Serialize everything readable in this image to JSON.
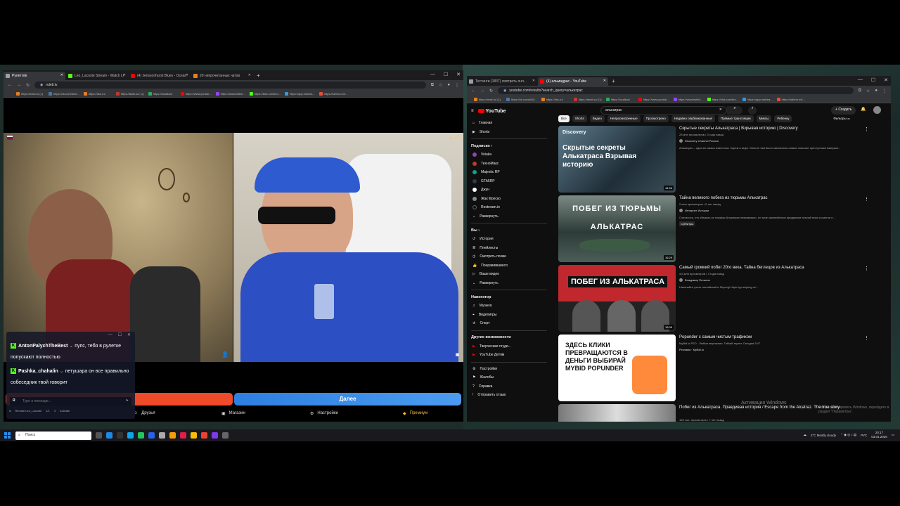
{
  "left_browser": {
    "tabs": [
      {
        "label": "Рулет EE",
        "color": "#9aa0a6",
        "active": true
      },
      {
        "label": "Leo_Lacoste Stream - Watch Li",
        "color": "#53fc18"
      },
      {
        "label": "(4) Jenssonhurst Blues - Ocean",
        "color": "#ff0000"
      },
      {
        "label": "20 непрочитанных чатов",
        "color": "#e67e22"
      }
    ],
    "url": "ruletl.tv",
    "bookmarks": [
      "https://mail.ru/ (1)",
      "https://vk.com/id10...",
      "https://oks.ru/",
      "https://tanki.su/ (1)",
      "https://localkus/",
      "https://www.youtub...",
      "https://www.twitch...",
      "https://kick.com/leo...",
      "https://app.restrea...",
      "https://stenvu.ml/..."
    ]
  },
  "roulette": {
    "star_count": "25",
    "next_label": "Далее",
    "nav": {
      "friends": "Друзья",
      "shop": "Магазин",
      "settings": "Настройки",
      "premium": "Премиум"
    }
  },
  "chat": {
    "messages": [
      {
        "user": "AntonPalychTheBest",
        "text": "пупс, тебя в рулетке попускают полностью"
      },
      {
        "user": "Pashka_chahalin",
        "text": "петушара он все правильно собеседник твой говорит"
      }
    ],
    "input_placeholder": "Type a message...",
    "footer_name": "Remain Leo_Lacoste",
    "footer_counts": [
      "1/1",
      "3"
    ],
    "footer_action": "Activate"
  },
  "right_browser": {
    "tabs": [
      {
        "label": "Тестинги (1837) смотреть онл...",
        "color": "#9aa0a6"
      },
      {
        "label": "(4) альмадрас - YouTube",
        "color": "#ff0000",
        "active": true
      }
    ],
    "url": "youtube.com/results?search_query=алькатрас",
    "bookmarks": [
      "https://mail.ru/ (1)",
      "https://vk.com/id10...",
      "https://oks.ru/",
      "https://tanki.su/ (1)",
      "https://localkus/",
      "https://www.youtub...",
      "https://www.twitch...",
      "https://kick.com/leo...",
      "https://app.restrea...",
      "https://adhrm.ml/..."
    ]
  },
  "youtube": {
    "logo": "YouTube",
    "search_value": "алькатрас",
    "create_label": "Создать",
    "sidebar_top": [
      "Главная",
      "Shorts"
    ],
    "subs_header": "Подписки",
    "subs": [
      "Voiaka",
      "ТехноМакс",
      "Majestic RP",
      "GTA5RP",
      "Джун",
      "Жак Фреско",
      "Restream.io",
      "Развернуть"
    ],
    "you_header": "Вы",
    "you": [
      "История",
      "Плейлисты",
      "Смотреть позже",
      "Понравившиеся",
      "Ваше видео",
      "Развернуть"
    ],
    "nav_header": "Навигатор",
    "nav": [
      "Музыка",
      "Видеоигры",
      "Спорт"
    ],
    "more_header": "Другие возможности",
    "more": [
      "Творческая студи...",
      "YouTube Детям"
    ],
    "bottom": [
      "Настройки",
      "Жалобы",
      "Справка",
      "Отправить отзыв"
    ],
    "chips": [
      "Все",
      "Shorts",
      "Видео",
      "Непросмотренные",
      "Просмотрено",
      "Недавно опубликованные",
      "Прямые трансляции",
      "Миксы",
      "Ребенку"
    ],
    "filters": "Фильтры",
    "videos": [
      {
        "title": "Скрытые секреты Алькатраса | Взрывая историю | Discovery",
        "meta": "23 млн просмотров • 3 года назад",
        "channel": "Discovery Channel Россия",
        "desc": "Алькатрас – одна из самых известных тюрем в мире. Многие там были заключены самые опасные преступники Америки...",
        "thumb_text": "Скрытые секреты Алькатраса Взрывая историю",
        "thumb_brand": "Discovery",
        "duration": "44:56"
      },
      {
        "title": "Тайна великого побега из тюрьмы Алькатрас",
        "meta": "2 млн просмотров • 5 лет назад",
        "channel": "Интернет Истории",
        "desc": "Считалось, что сбежать из тюрьмы Алькатрас невозможно, но трое заключённых придумали хитрый план и смогли п...",
        "badge": "Субтитры",
        "thumb_text": "ПОБЕГ ИЗ ТЮРЬМЫ АЛЬКАТРАС",
        "duration": "16:29"
      },
      {
        "title": "Самый громкий побег 20го века. Тайна беглецов из Алькатраса",
        "meta": "4,5 млн просмотров • 3 года назад",
        "channel": "Владимир Потапов",
        "desc": "Начинайте учить английский в Skyeng! https://go.skyeng.ru/...",
        "thumb_text": "ПОБЕГ ИЗ АЛЬКАТРАСА",
        "duration": "15:38"
      },
      {
        "title": "Popunder с самым чистым трафиком",
        "meta": "MyBid.io FEO · Любые вертикали. Гибкий таргет. Сегодня 24/7.",
        "channel": "Реклама · MyBid.io",
        "desc": "",
        "thumb_text": "ЗДЕСЬ КЛИКИ ПРЕВРАЩАЮТСЯ В ДЕНЬГИ ВЫБИРАЙ MYBID POPUNDER",
        "duration": ""
      },
      {
        "title": "Побег из Алькатраса. Правдивая история / Escape from the Alcatraz. The true story",
        "meta": "163 тыс. просмотров • 7 лет назад",
        "channel": "",
        "desc": "",
        "duration": ""
      }
    ],
    "watermark": "Активация Windows",
    "watermark2": "Чтобы активировать Windows, перейдите в раздел \"Параметры\"."
  },
  "taskbar": {
    "search_placeholder": "Поиск",
    "weather": "2°C  Mostly cloudy",
    "lang": "РУС",
    "time": "20:17",
    "date": "03.01.2026"
  }
}
